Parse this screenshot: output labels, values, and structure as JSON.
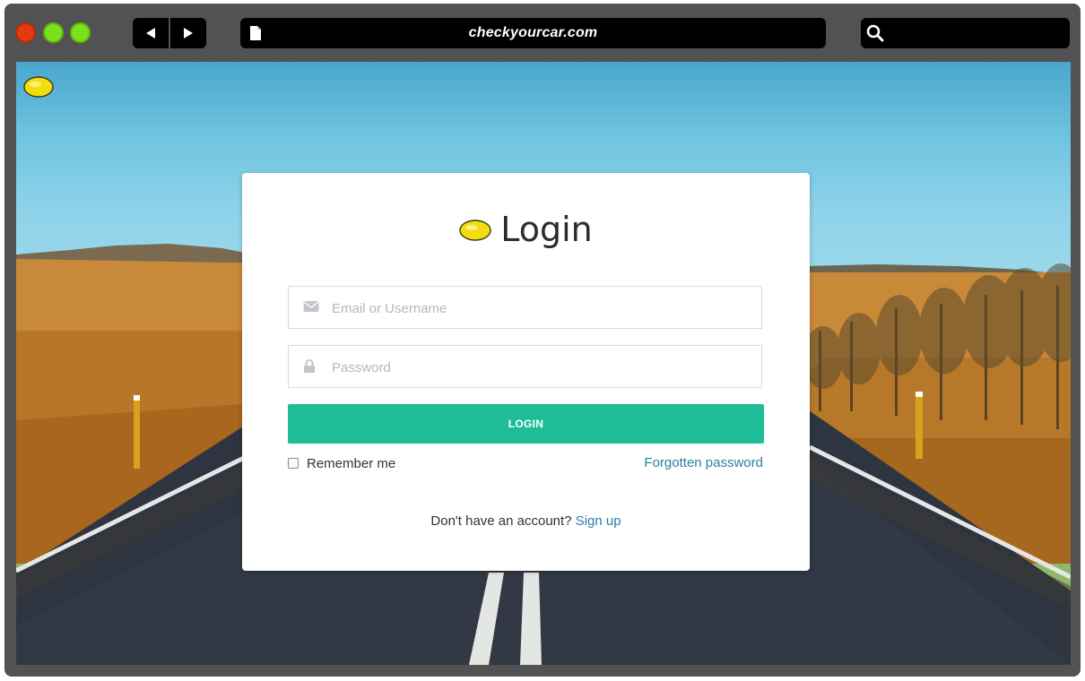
{
  "browser": {
    "url": "checkyourcar.com"
  },
  "login": {
    "title": "Login",
    "email_placeholder": "Email or Username",
    "password_placeholder": "Password",
    "submit_label": "LOGIN",
    "remember_label": "Remember me",
    "forgot_label": "Forgotten password",
    "signup_prompt": "Don't have an account?",
    "signup_link": "Sign up"
  },
  "colors": {
    "accent": "#1ebd98",
    "link": "#2d7ea5",
    "traffic_red": "#e03a12",
    "traffic_green": "#7de01c",
    "chrome": "#525252"
  },
  "icons": {
    "logo": "lemon-icon",
    "email_field": "envelope-icon",
    "password_field": "lock-icon",
    "url_bar": "page-icon",
    "search": "search-icon"
  }
}
